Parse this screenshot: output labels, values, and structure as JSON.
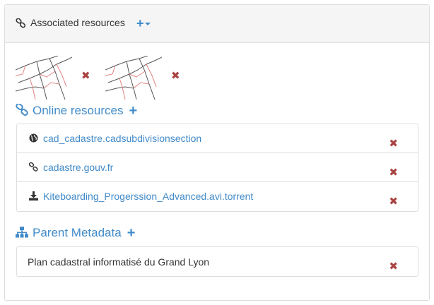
{
  "associated": {
    "title": "Associated resources",
    "add_label": "+",
    "remove_label": "✖"
  },
  "online": {
    "title": "Online resources",
    "add_label": "+",
    "items": [
      {
        "label": "cad_cadastre.cadsubdivisionsection",
        "icon": "globe-icon"
      },
      {
        "label": "cadastre.gouv.fr",
        "icon": "link-icon"
      },
      {
        "label": "Kiteboarding_Progerssion_Advanced.avi.torrent",
        "icon": "download-icon"
      }
    ],
    "remove_label": "✖"
  },
  "parent": {
    "title": "Parent Metadata",
    "add_label": "+",
    "items": [
      {
        "label": "Plan cadastral informatisé du Grand Lyon"
      }
    ],
    "remove_label": "✖"
  },
  "colors": {
    "link": "#428bca",
    "delete": "#a94442",
    "heading_bg": "#f5f5f5",
    "border": "#dddddd"
  }
}
